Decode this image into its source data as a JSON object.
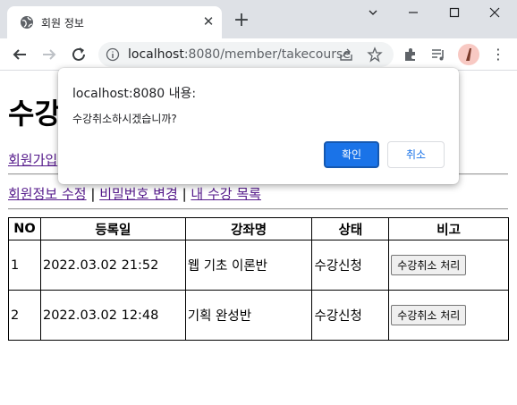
{
  "browser": {
    "tab_title": "회원 정보",
    "url_host": "localhost",
    "url_rest": ":8080/member/takecourse"
  },
  "page": {
    "title": "수강",
    "signup_link": "회원가입",
    "edit_info_link": "회원정보 수정",
    "separator": "|",
    "change_password_link": "비밀번호 변경",
    "my_courses_link": "내 수강 목록"
  },
  "table": {
    "headers": [
      "NO",
      "등록일",
      "강좌명",
      "상태",
      "비고"
    ],
    "rows": [
      {
        "no": "1",
        "date": "2022.03.02 21:52",
        "course": "웹 기초 이론반",
        "status": "수강신청",
        "action": "수강취소 처리"
      },
      {
        "no": "2",
        "date": "2022.03.02 12:48",
        "course": "기획 완성반",
        "status": "수강신청",
        "action": "수강취소 처리"
      }
    ]
  },
  "dialog": {
    "title": "localhost:8080 내용:",
    "message": "수강취소하시겠습니까?",
    "ok_label": "확인",
    "cancel_label": "취소"
  },
  "colors": {
    "accent": "#1a73e8",
    "link": "#551a8b",
    "tabstrip": "#dee1e6"
  }
}
